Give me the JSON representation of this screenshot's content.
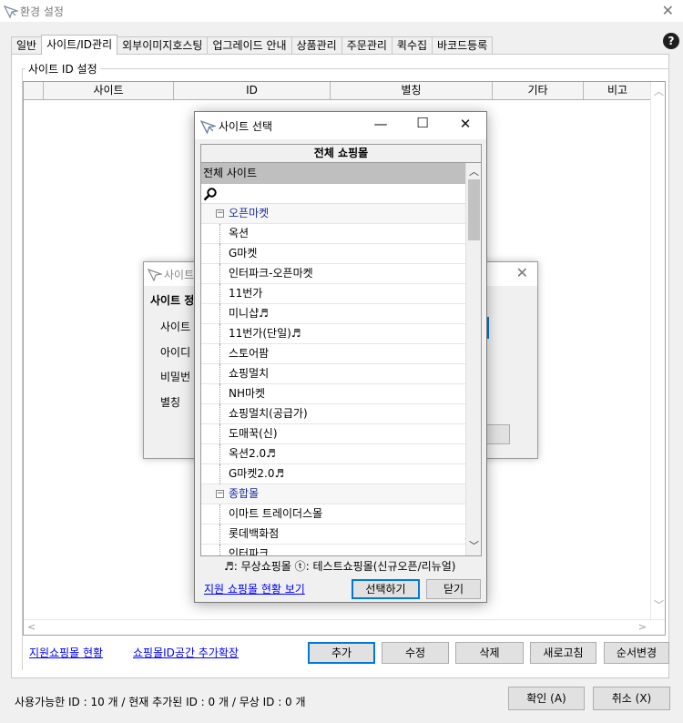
{
  "window": {
    "title": "환경 설정"
  },
  "tabs": [
    "일반",
    "사이트/ID관리",
    "외부이미지호스팅",
    "업그레이드 안내",
    "상품관리",
    "주문관리",
    "퀵수집",
    "바코드등록"
  ],
  "active_tab_index": 1,
  "help_label": "?",
  "group_label": "사이트 ID 설정",
  "grid": {
    "columns": [
      "",
      "사이트",
      "ID",
      "별칭",
      "기타",
      "비고"
    ]
  },
  "bottom_links": {
    "status_link": "지원쇼핑몰 현황",
    "expand_link": "쇼핑몰ID공간 추가확장"
  },
  "buttons": {
    "add": "추가",
    "edit": "수정",
    "delete": "삭제",
    "refresh": "새로고침",
    "reorder": "순서변경",
    "ok": "확인 (A)",
    "cancel": "취소 (X)"
  },
  "status_text": "사용가능한 ID : 10 개 / 현재 추가된 ID : 0 개 / 무상 ID : 0 개",
  "background_dialog": {
    "title": "사이트",
    "section": "사이트 정",
    "labels": [
      "사이트",
      "아이디",
      "비밀번",
      "별칭"
    ]
  },
  "site_dialog": {
    "title": "사이트 선택",
    "header": "전체 쇼핑몰",
    "list_header": "전체 사이트",
    "categories": [
      {
        "name": "오픈마켓",
        "items": [
          "옥션",
          "G마켓",
          "인터파크-오픈마켓",
          "11번가",
          "미니샵♬",
          "11번가(단일)♬",
          "스토어팜",
          "쇼핑멀치",
          "NH마켓",
          "쇼핑멀치(공급가)",
          "도매꾹(신)",
          "옥션2.0♬",
          "G마켓2.0♬"
        ]
      },
      {
        "name": "종합몰",
        "items": [
          "이마트 트레이더스몰",
          "롯데백화점",
          "인터파크"
        ]
      }
    ],
    "legend": "♬: 무상쇼핑몰  ⓣ: 테스트쇼핑몰(신규오픈/리뉴얼)",
    "link": "지원 쇼핑몰 현황 보기",
    "select_button": "선택하기",
    "close_button": "닫기"
  },
  "colors": {
    "accent": "#0078d7",
    "link": "#0000ff",
    "category_text": "#1a2a9a"
  }
}
